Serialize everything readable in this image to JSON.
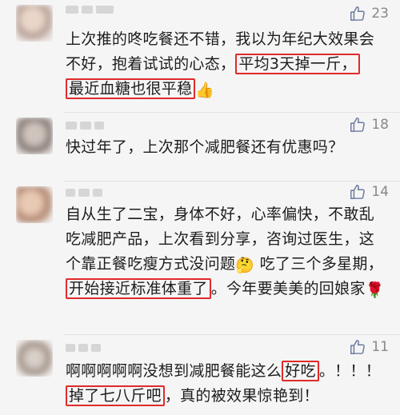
{
  "comments": [
    {
      "likes": "23",
      "text_before": "上次推的咚吃餐还不错，我以为年纪大效果会不好，抱着试试的心态，",
      "highlight_1": "平均3天掉一斤，",
      "highlight_2": "最近血糖也很平稳",
      "emoji": "👍"
    },
    {
      "likes": "18",
      "text": "快过年了，上次那个减肥餐还有优惠吗？"
    },
    {
      "likes": "14",
      "text_before": "自从生了二宝，身体不好，心率偏快，不敢乱吃减肥产品，上次看到分享，咨询过医生，这个靠正餐吃瘦方式没问题",
      "emoji_1": "🤔",
      "text_mid": "吃了三个多星期，",
      "highlight": "开始接近标准体重了",
      "text_after": "。今年要美美的回娘家",
      "emoji_2": "🌹"
    },
    {
      "likes": "11",
      "text_before": "啊啊啊啊啊没想到减肥餐能这么",
      "highlight_1": "好吃",
      "text_mid": "。！！！",
      "highlight_2": "掉了七八斤吧",
      "text_after": "，真的被效果惊艳到！"
    }
  ],
  "colors": {
    "highlight_border": "#e02a2a",
    "like_color": "#888888"
  },
  "icons": {
    "like": "thumbs-up-icon"
  }
}
